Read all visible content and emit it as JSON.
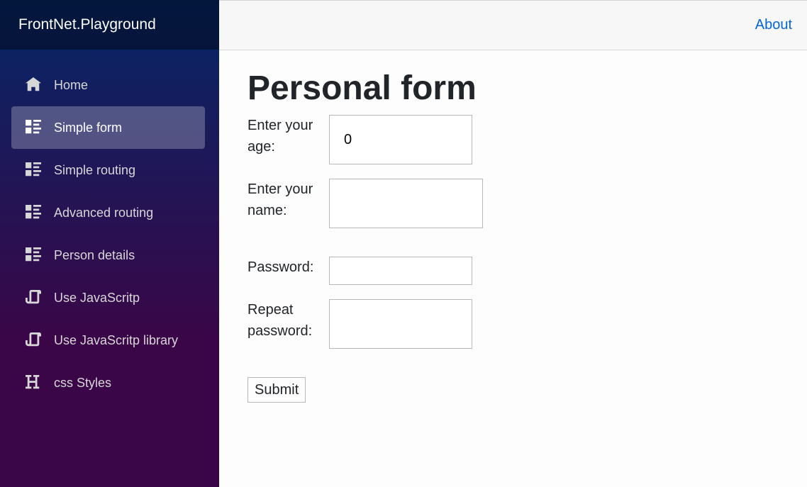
{
  "sidebar": {
    "brand": "FrontNet.Playground",
    "items": [
      {
        "label": "Home",
        "icon": "home-icon"
      },
      {
        "label": "Simple form",
        "icon": "list-rich-icon",
        "active": true
      },
      {
        "label": "Simple routing",
        "icon": "list-rich-icon"
      },
      {
        "label": "Advanced routing",
        "icon": "list-rich-icon"
      },
      {
        "label": "Person details",
        "icon": "list-rich-icon"
      },
      {
        "label": "Use JavaScritp",
        "icon": "script-icon"
      },
      {
        "label": "Use JavaScritp library",
        "icon": "script-icon"
      },
      {
        "label": "css Styles",
        "icon": "header-icon"
      }
    ]
  },
  "header": {
    "about_label": "About"
  },
  "main": {
    "title": "Personal form",
    "form": {
      "age_label": "Enter your age:",
      "age_value": "0",
      "name_label": "Enter your name:",
      "name_value": "",
      "password_label": "Password:",
      "password_value": "",
      "repeat_password_label": "Repeat password:",
      "repeat_password_value": "",
      "submit_label": "Submit"
    }
  },
  "colors": {
    "sidebar_top": "#052767",
    "sidebar_bottom": "#3a0647",
    "link": "#0366d6"
  }
}
